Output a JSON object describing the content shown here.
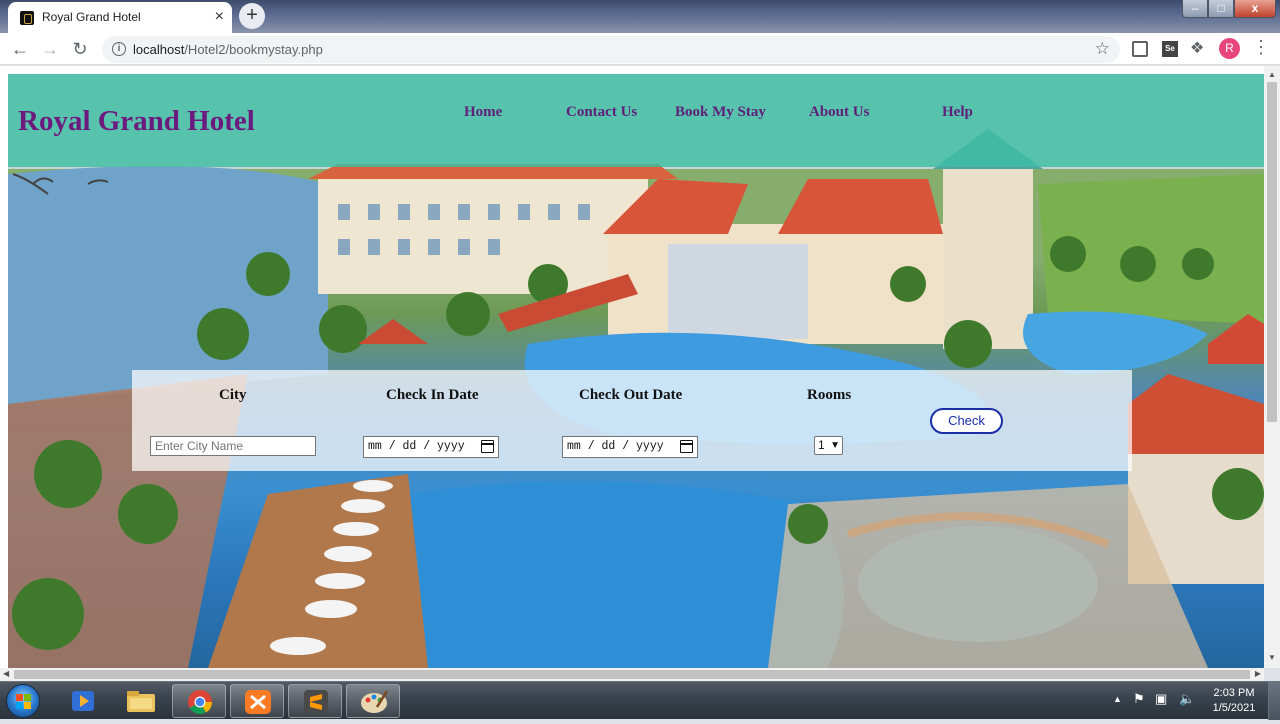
{
  "browser": {
    "tab_title": "Royal Grand Hotel",
    "tab_close": "×",
    "new_tab": "+",
    "url_host": "localhost",
    "url_path": "/Hotel2/bookmystay.php",
    "avatar_letter": "R",
    "window_controls": {
      "minimize": "–",
      "maximize": "□",
      "close": "x"
    }
  },
  "site": {
    "brand": "Royal Grand Hotel",
    "nav": [
      {
        "label": "Home"
      },
      {
        "label": "Contact Us"
      },
      {
        "label": "Book My Stay"
      },
      {
        "label": "About Us"
      },
      {
        "label": "Help"
      }
    ]
  },
  "booking": {
    "city_label": "City",
    "checkin_label": "Check In Date",
    "checkout_label": "Check Out Date",
    "rooms_label": "Rooms",
    "city_placeholder": "Enter City Name",
    "date_placeholder": "mm / dd / yyyy",
    "rooms_value": "1",
    "check_button": "Check"
  },
  "taskbar": {
    "time": "2:03 PM",
    "date": "1/5/2021",
    "apps": [
      "media-player",
      "file-explorer",
      "chrome",
      "xampp",
      "sublime-text",
      "paint"
    ]
  },
  "colors": {
    "header_bar": "#40bea5",
    "brand_text": "#6c1a7e",
    "nav_text": "#5d1f7a",
    "check_button_border": "#1b2ea6"
  }
}
